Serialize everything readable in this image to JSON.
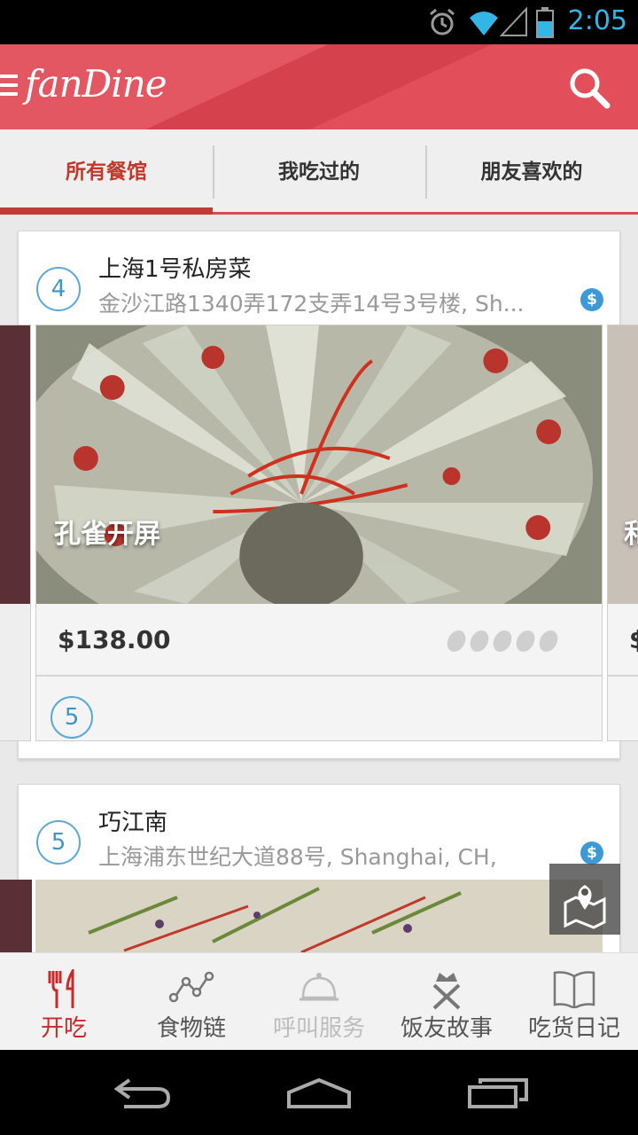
{
  "status_bar": {
    "time": "2:05"
  },
  "app_bar": {
    "logo": "fanDine"
  },
  "tabs": [
    {
      "label": "所有餐馆",
      "active": true
    },
    {
      "label": "我吃过的",
      "active": false
    },
    {
      "label": "朋友喜欢的",
      "active": false
    }
  ],
  "restaurants": [
    {
      "rank": "4",
      "name": "上海1号私房菜",
      "address": "金沙江路1340弄172支弄14号3号楼, Sh...",
      "price_icon": "$",
      "dishes": [
        {
          "name": "孔雀开屏",
          "price": "$138.00",
          "rank": "5",
          "rating": 0
        }
      ],
      "next_dish_partial": {
        "name": "和",
        "price": "$"
      }
    },
    {
      "rank": "5",
      "name": "巧江南",
      "address": "上海浦东世纪大道88号, Shanghai, CH,",
      "price_icon": "$"
    }
  ],
  "bottom_nav": [
    {
      "label": "开吃",
      "icon": "fork-knife-icon",
      "state": "active"
    },
    {
      "label": "食物链",
      "icon": "food-chain-icon",
      "state": "normal"
    },
    {
      "label": "呼叫服务",
      "icon": "service-bell-icon",
      "state": "disabled"
    },
    {
      "label": "饭友故事",
      "icon": "crown-utensils-icon",
      "state": "normal"
    },
    {
      "label": "吃货日记",
      "icon": "diary-book-icon",
      "state": "normal"
    }
  ],
  "colors": {
    "brand": "#e04450",
    "accent_blue": "#3d95c8",
    "active_red": "#c82a2a"
  }
}
